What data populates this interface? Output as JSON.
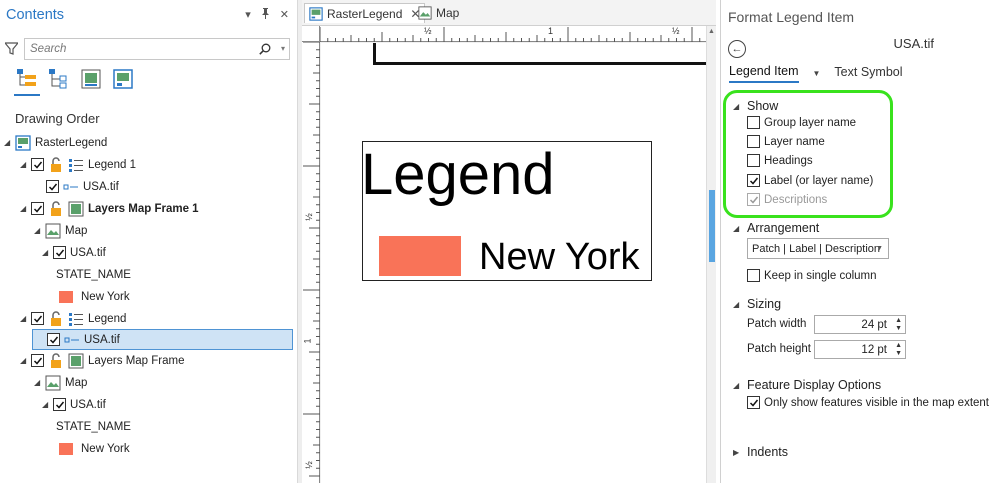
{
  "contents": {
    "title": "Contents",
    "controls": [
      "▾",
      "📌",
      "✕"
    ],
    "search_placeholder": "Search",
    "drawing_order_label": "Drawing Order",
    "tree": [
      {
        "label": "RasterLegend",
        "indent": 0,
        "type": "layout",
        "check": false,
        "bold": false
      },
      {
        "label": "Legend 1",
        "indent": 1,
        "type": "legend",
        "check": true,
        "bold": false
      },
      {
        "label": "USA.tif",
        "indent": 2,
        "type": "legend-item",
        "check": true,
        "bold": false
      },
      {
        "label": "Layers Map Frame 1",
        "indent": 1,
        "type": "mapframe",
        "check": true,
        "bold": true
      },
      {
        "label": "Map",
        "indent": 2,
        "type": "map",
        "check": false,
        "bold": false
      },
      {
        "label": "USA.tif",
        "indent": 3,
        "type": "raster",
        "check": true,
        "bold": false
      },
      {
        "label": "STATE_NAME",
        "indent": 4,
        "type": "text",
        "check": false,
        "bold": false
      },
      {
        "label": "New York",
        "indent": 4,
        "type": "swatch",
        "check": false,
        "bold": false
      },
      {
        "label": "Legend",
        "indent": 1,
        "type": "legend",
        "check": true,
        "bold": false
      },
      {
        "label": "USA.tif",
        "indent": 2,
        "type": "legend-item",
        "check": true,
        "bold": false,
        "selected": true
      },
      {
        "label": "Layers Map Frame",
        "indent": 1,
        "type": "mapframe",
        "check": true,
        "bold": false
      },
      {
        "label": "Map",
        "indent": 2,
        "type": "map",
        "check": false,
        "bold": false
      },
      {
        "label": "USA.tif",
        "indent": 3,
        "type": "raster",
        "check": true,
        "bold": false
      },
      {
        "label": "STATE_NAME",
        "indent": 4,
        "type": "text",
        "check": false,
        "bold": false
      },
      {
        "label": "New York",
        "indent": 4,
        "type": "swatch",
        "check": false,
        "bold": false
      }
    ]
  },
  "layout": {
    "tabs": [
      {
        "label": "RasterLegend",
        "active": true,
        "close": "✕"
      },
      {
        "label": "Map",
        "active": false
      }
    ],
    "ruler_labels": {
      "h": [
        "½",
        "1",
        "½"
      ],
      "v": [
        "½",
        "1",
        "½"
      ]
    },
    "legend": {
      "title": "Legend",
      "item_label": "New York"
    }
  },
  "format": {
    "title": "Format Legend Item",
    "item_name": "USA.tif",
    "tabs": {
      "legend_item": "Legend Item",
      "text_symbol": "Text Symbol"
    },
    "show": {
      "label": "Show",
      "options": [
        {
          "label": "Group layer name",
          "checked": false,
          "disabled": false
        },
        {
          "label": "Layer name",
          "checked": false,
          "disabled": false
        },
        {
          "label": "Headings",
          "checked": false,
          "disabled": false
        },
        {
          "label": "Label (or layer name)",
          "checked": true,
          "disabled": false
        },
        {
          "label": "Descriptions",
          "checked": true,
          "disabled": true
        }
      ]
    },
    "arrangement": {
      "label": "Arrangement",
      "value": "Patch | Label | Description",
      "keep_single": "Keep in single column"
    },
    "sizing": {
      "label": "Sizing",
      "patch_width_label": "Patch width",
      "patch_width": "24 pt",
      "patch_height_label": "Patch height",
      "patch_height": "12 pt"
    },
    "feature_display": {
      "label": "Feature Display Options",
      "option": "Only show features visible in the map extent"
    },
    "indents": {
      "label": "Indents"
    }
  },
  "colors": {
    "accent": "#2b78c5",
    "patch": "#f97358",
    "highlight": "#39e21d",
    "selection": "#cfe3f5"
  }
}
